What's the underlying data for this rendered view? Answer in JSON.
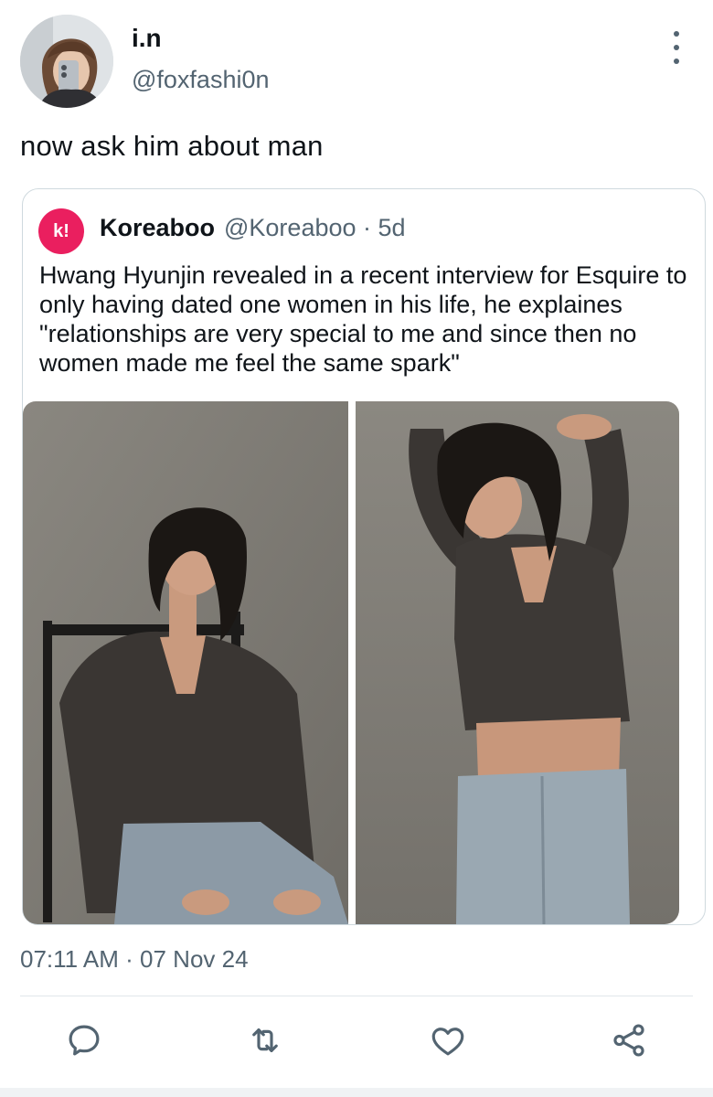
{
  "author": {
    "display_name": "i.n",
    "handle": "@foxfashi0n"
  },
  "tweet": {
    "text": "now ask him about man",
    "timestamp": "07:11 AM · 07 Nov 24"
  },
  "quoted_tweet": {
    "avatar_text": "k!",
    "display_name": "Koreaboo",
    "meta": "@Koreaboo · 5d",
    "text": "Hwang Hyunjin revealed in a recent interview for Esquire to only having dated one women in his life, he explaines \"relationships are very special to me and since then no women made me feel the same spark\""
  },
  "actions": [
    "reply-icon",
    "retweet-icon",
    "like-icon",
    "share-icon"
  ],
  "colors": {
    "text_primary": "#0f1419",
    "text_secondary": "#536471",
    "border": "#cfd9de",
    "koreaboo_brand": "#ea1f5f"
  }
}
